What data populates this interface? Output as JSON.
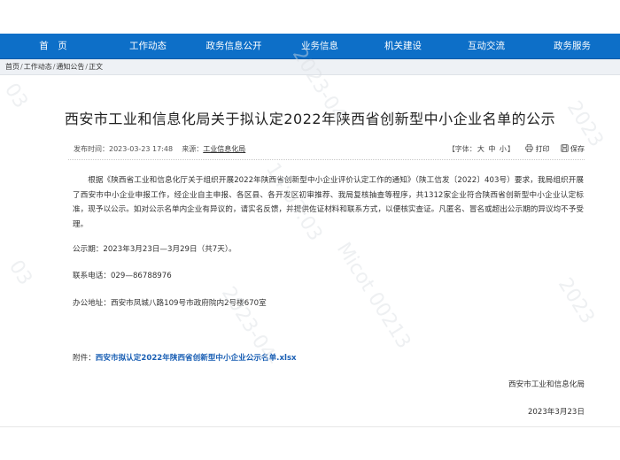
{
  "nav": {
    "items": [
      "首　页",
      "工作动态",
      "政务信息公开",
      "业务信息",
      "机关建设",
      "互动交流",
      "政务服务"
    ]
  },
  "breadcrumb": {
    "items": [
      "首页",
      "工作动态",
      "通知公告",
      "正文"
    ]
  },
  "article": {
    "title": "西安市工业和信息化局关于拟认定2022年陕西省创新型中小企业名单的公示",
    "publish_label": "发布时间：",
    "publish_time": "2023-03-23 17:48",
    "source_label": "来源：",
    "source": "工业信息化局",
    "font_label": "【字体：",
    "font_sizes": [
      "大",
      "中",
      "小"
    ],
    "font_close": "】",
    "print_label": "打印",
    "save_label": "保存",
    "body_paragraph": "根据《陕西省工业和信息化厅关于组织开展2022年陕西省创新型中小企业评价认定工作的通知》（陕工信发〔2022〕403号）要求，我局组织开展了西安市中小企业申报工作，经企业自主申报、各区县、各开发区初审推荐、我局复核抽查等程序，共1312家企业符合陕西省创新型中小企业认定标准，现予以公示。如对公示名单内企业有异议的，请实名反馈，并提供佐证材料和联系方式，以便核实查证。凡匿名、冒名或超出公示期的异议均不予受理。",
    "period": "公示期：2023年3月23日—3月29日（共7天）。",
    "phone": "联系电话：029—86788976",
    "address": "办公地址：西安市凤城八路109号市政府院内2号楼670室",
    "attachment_label": "附件：",
    "attachment_link": "西安市拟认定2022年陕西省创新型中小企业公示名单.xlsx",
    "signature_org": "西安市工业和信息化局",
    "signature_date": "2023年3月23日"
  },
  "colors": {
    "nav_bg": "#0d6fc8",
    "link": "#1a5fb4"
  },
  "icons": [
    "printer-icon",
    "save-icon"
  ]
}
